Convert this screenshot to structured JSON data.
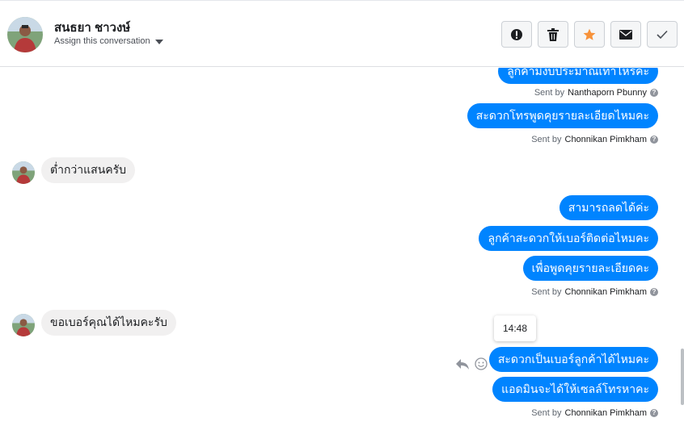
{
  "header": {
    "contact_name": "สนธยา ชาวงษ์",
    "assign_label": "Assign this conversation",
    "actions": [
      {
        "name": "mark-spam",
        "icon": "alert-icon"
      },
      {
        "name": "delete",
        "icon": "trash-icon"
      },
      {
        "name": "star",
        "icon": "star-icon",
        "color": "#f7923a"
      },
      {
        "name": "mark-unread",
        "icon": "envelope-icon"
      },
      {
        "name": "mark-done",
        "icon": "check-icon"
      }
    ]
  },
  "messages": {
    "m1": "ลูกค้ามีงบประมาณเท่าไหร่คะ",
    "sent1_prefix": "Sent by",
    "sent1_name": "Nanthaporn Pbunny",
    "m2": "สะดวกโทรพูดคุยรายละเอียดไหมคะ",
    "sent2_prefix": "Sent by",
    "sent2_name": "Chonnikan Pimkham",
    "in1": "ต่ำกว่าแสนครับ",
    "m3": "สามารถลดได้ค่ะ",
    "m4": "ลูกค้าสะดวกให้เบอร์ติดต่อไหมคะ",
    "m5": "เพื่อพูดคุยรายละเอียดคะ",
    "sent3_prefix": "Sent by",
    "sent3_name": "Chonnikan Pimkham",
    "in2": "ขอเบอร์คุณได้ไหมคะรับ",
    "tooltip_time": "14:48",
    "m6": "สะดวกเป็นเบอร์ลูกค้าได้ไหมคะ",
    "m7": "แอดมินจะได้ให้เซลล์โทรหาคะ",
    "sent4_prefix": "Sent by",
    "sent4_name": "Chonnikan Pimkham"
  },
  "colors": {
    "outgoing_bubble": "#0084ff",
    "incoming_bubble": "#f1f0f0",
    "star_accent": "#f7923a"
  }
}
